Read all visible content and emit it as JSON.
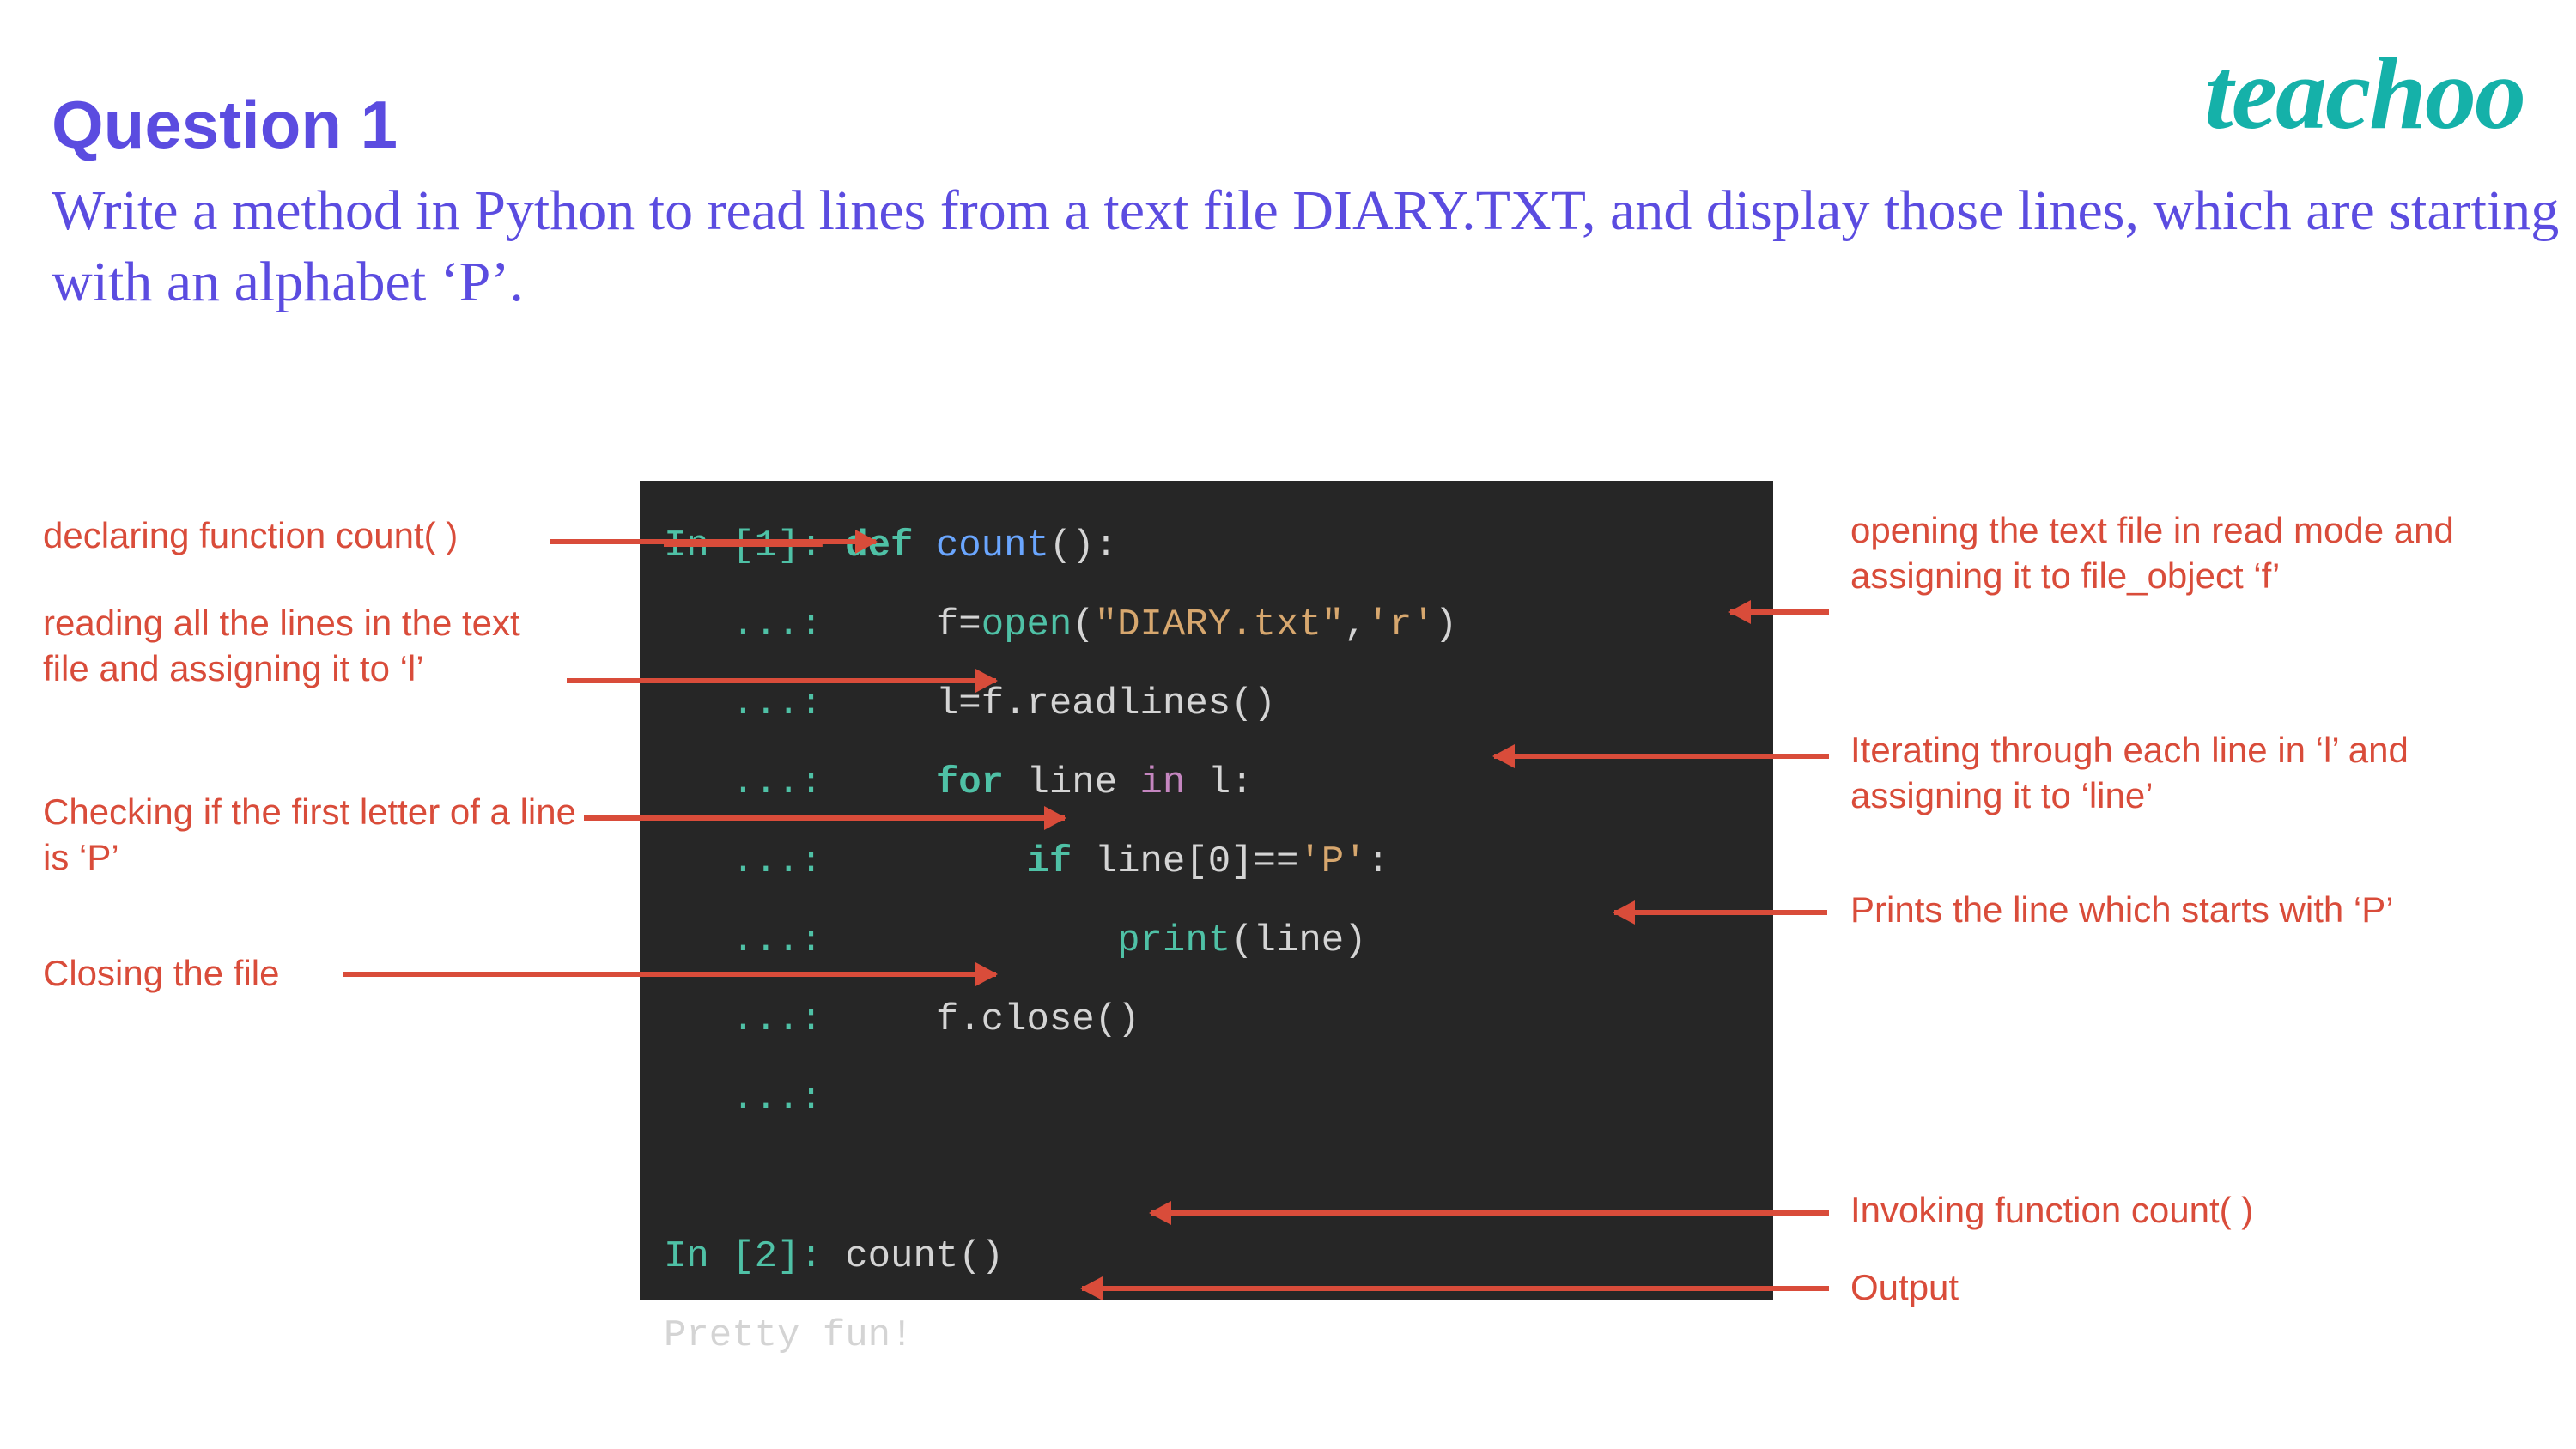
{
  "brand": {
    "logo": "teachoo"
  },
  "heading": "Question 1",
  "subheading": "Write a method in Python to read lines from a text  file DIARY.TXT, and display those lines, which  are starting with an alphabet ‘P’.",
  "code": {
    "prompt1": "In [1]:",
    "cont": "...:",
    "l1": {
      "kw": "def",
      "fn": "count",
      "tail": "():"
    },
    "l2": {
      "v": "f",
      "eq": "=",
      "fn": "open",
      "args_open": "(",
      "s1": "\"DIARY.txt\"",
      "comma": ",",
      "s2": "'r'",
      "args_close": ")"
    },
    "l3": {
      "v": "l",
      "eq": "=",
      "call": "f.readlines()"
    },
    "l4": {
      "kw": "for",
      "v1": "line",
      "in": "in",
      "v2": "l",
      "colon": ":"
    },
    "l5": {
      "kw": "if",
      "expr": "line[0]==",
      "s": "'P'",
      "colon": ":"
    },
    "l6": {
      "fn": "print",
      "args": "(line)"
    },
    "l7": {
      "call": "f.close()"
    },
    "prompt2": "In [2]:",
    "invoke": "count()",
    "output": "Pretty fun!"
  },
  "annotations": {
    "left1": "declaring function count( )",
    "left2": "reading all the lines in the text file and assigning it to ‘l’",
    "left3": "Checking if the first letter of a line is ‘P’",
    "left4": "Closing the file",
    "right1": "opening the text file in read mode and assigning it to file_object ‘f’",
    "right2": "Iterating through each line in ‘l’ and assigning it to ‘line’",
    "right3": "Prints the line which starts with ‘P’",
    "right4": "Invoking function count( )",
    "right5": "Output"
  }
}
